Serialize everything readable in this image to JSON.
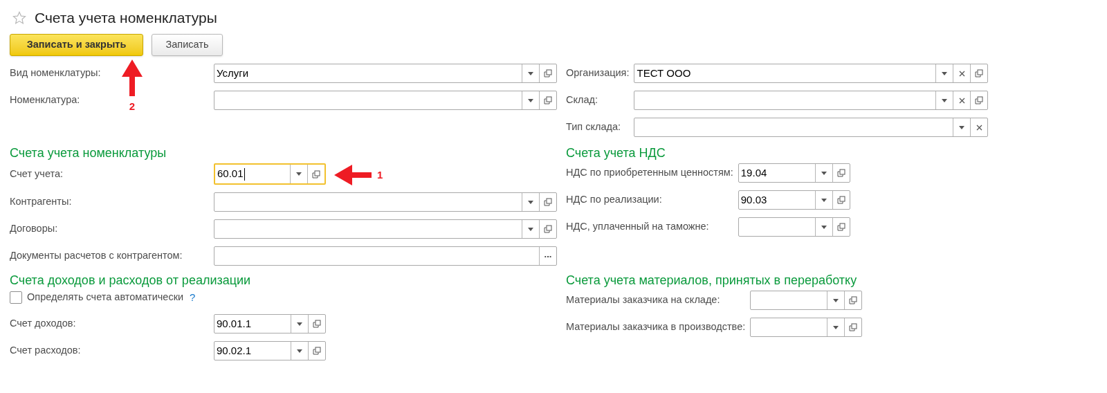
{
  "title": "Счета учета номенклатуры",
  "favorite": false,
  "buttons": [
    {
      "label": "Записать и закрыть",
      "kind": "primary",
      "annotation": "2"
    },
    {
      "label": "Записать",
      "kind": "default"
    }
  ],
  "groups": [
    {
      "left": {
        "items": [
          {
            "kind": "field",
            "label": "Вид номенклатуры:",
            "value": "Услуги",
            "focused": false,
            "buttons": [
              {
                "kind": "dropdown"
              },
              {
                "kind": "open"
              }
            ]
          },
          {
            "kind": "field",
            "label": "Номенклатура:",
            "focused": false,
            "buttons": [
              {
                "kind": "dropdown"
              },
              {
                "kind": "open"
              }
            ]
          }
        ]
      },
      "right": {
        "items": [
          {
            "kind": "field",
            "label": "Организация:",
            "value": "ТЕСТ ООО",
            "focused": false,
            "buttons": [
              {
                "kind": "dropdown"
              },
              {
                "kind": "clear"
              },
              {
                "kind": "open"
              }
            ]
          },
          {
            "kind": "field",
            "label": "Склад:",
            "focused": false,
            "buttons": [
              {
                "kind": "dropdown"
              },
              {
                "kind": "clear"
              },
              {
                "kind": "open"
              }
            ]
          },
          {
            "kind": "field",
            "label": "Тип склада:",
            "focused": false,
            "buttons": [
              {
                "kind": "dropdown"
              },
              {
                "kind": "clear"
              }
            ]
          }
        ]
      }
    },
    {
      "left": {
        "heading": "Счета учета номенклатуры",
        "items": [
          {
            "kind": "short_field",
            "label": "Счет учета:",
            "value": "60.01",
            "focused": true,
            "annotation": "1",
            "buttons": [
              {
                "kind": "dropdown"
              },
              {
                "kind": "open"
              }
            ]
          },
          {
            "kind": "field",
            "label": "Контрагенты:",
            "focused": false,
            "buttons": [
              {
                "kind": "dropdown"
              },
              {
                "kind": "open"
              }
            ]
          },
          {
            "kind": "field",
            "label": "Договоры:",
            "focused": false,
            "buttons": [
              {
                "kind": "dropdown"
              },
              {
                "kind": "open"
              }
            ]
          },
          {
            "kind": "field",
            "label": "Документы расчетов с контрагентом:",
            "focused": false,
            "buttons": [
              {
                "kind": "select",
                "text": "..."
              }
            ]
          }
        ]
      },
      "right": {
        "heading": "Счета учета НДС",
        "items": [
          {
            "kind": "short_field",
            "label": "НДС по приобретенным ценностям:",
            "value": "19.04",
            "focused": false,
            "buttons": [
              {
                "kind": "dropdown"
              },
              {
                "kind": "open"
              }
            ]
          },
          {
            "kind": "short_field",
            "label": "НДС по реализации:",
            "value": "90.03",
            "focused": false,
            "buttons": [
              {
                "kind": "dropdown"
              },
              {
                "kind": "open"
              }
            ]
          },
          {
            "kind": "short_field",
            "label": "НДС, уплаченный на таможне:",
            "focused": false,
            "buttons": [
              {
                "kind": "dropdown"
              },
              {
                "kind": "open"
              }
            ]
          }
        ]
      }
    },
    {
      "left": {
        "heading": "Счета доходов и расходов от реализации",
        "items": [
          {
            "kind": "checkbox",
            "label": "Определять счета автоматически",
            "checked": false,
            "help": "?"
          },
          {
            "kind": "short_field",
            "label": "Счет доходов:",
            "value": "90.01.1",
            "focused": false,
            "buttons": [
              {
                "kind": "dropdown"
              },
              {
                "kind": "open"
              }
            ]
          },
          {
            "kind": "short_field",
            "label": "Счет расходов:",
            "value": "90.02.1",
            "focused": false,
            "buttons": [
              {
                "kind": "dropdown"
              },
              {
                "kind": "open"
              }
            ]
          }
        ]
      },
      "right": {
        "heading": "Счета учета материалов, принятых в переработку",
        "items": [
          {
            "kind": "short_field",
            "label": "Материалы заказчика на складе:",
            "focused": false,
            "buttons": [
              {
                "kind": "dropdown"
              },
              {
                "kind": "open"
              }
            ]
          },
          {
            "kind": "short_field",
            "label": "Материалы заказчика в производстве:",
            "focused": false,
            "buttons": [
              {
                "kind": "dropdown"
              },
              {
                "kind": "open"
              }
            ]
          }
        ]
      }
    }
  ]
}
